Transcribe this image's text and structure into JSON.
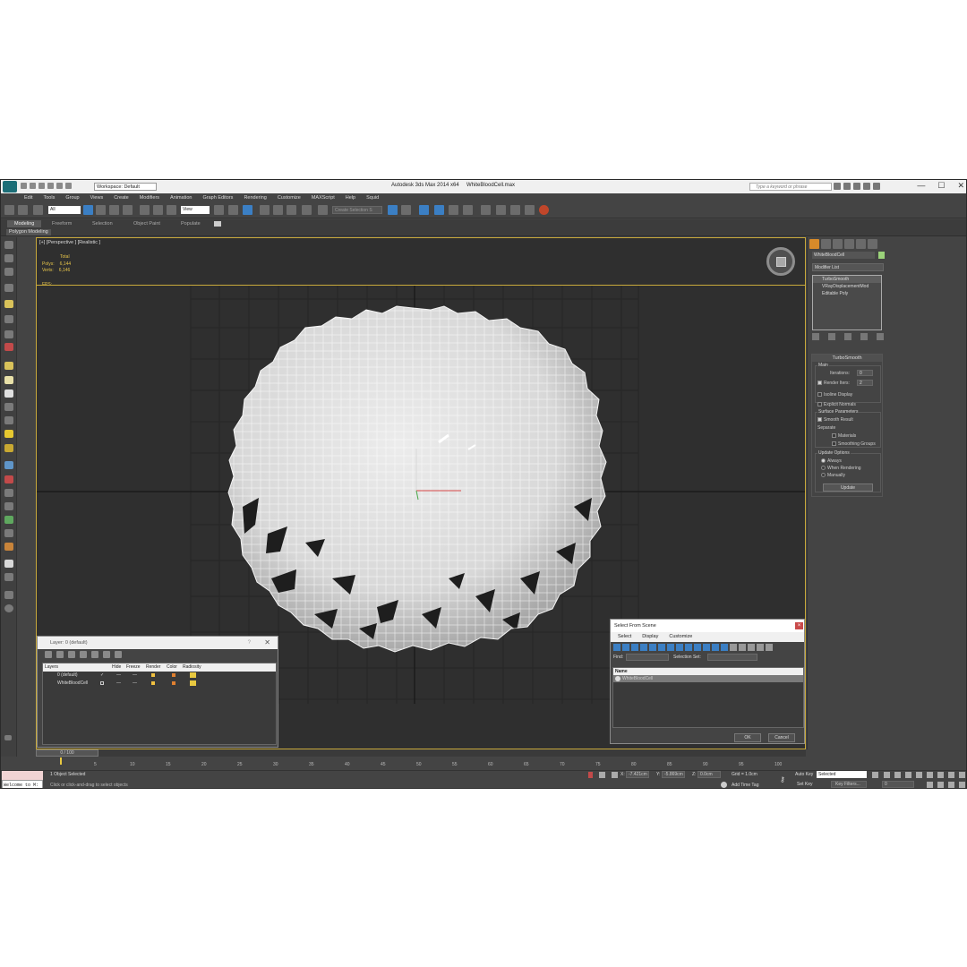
{
  "window": {
    "app_title": "Autodesk 3ds Max  2014 x64",
    "file_name": "WhiteBloodCell.max",
    "workspace": "Workspace: Default",
    "search_placeholder": "Type a keyword or phrase",
    "controls": [
      "—",
      "☐",
      "✕"
    ]
  },
  "menu": [
    "Edit",
    "Tools",
    "Group",
    "Views",
    "Create",
    "Modifiers",
    "Animation",
    "Graph Editors",
    "Rendering",
    "Customize",
    "MAXScript",
    "Help",
    "Squid"
  ],
  "toolbar": {
    "selection_filter": "All",
    "reference_coord": "View",
    "named_selection": "Create Selection S"
  },
  "ribbon": {
    "tabs": [
      "Modeling",
      "Freeform",
      "Selection",
      "Object Paint",
      "Populate"
    ],
    "active_tab": "Modeling",
    "panel": "Polygon Modeling"
  },
  "viewport": {
    "label": "[+] [Perspective ] [Realistic ]",
    "stats": {
      "total_label": "Total",
      "polys_label": "Polys:",
      "polys_value": "6,144",
      "verts_label": "Verts:",
      "verts_value": "6,146",
      "fps_label": "FPS:"
    }
  },
  "command_panel": {
    "object_name": "WhiteBloodCell",
    "object_color": "#9bd27a",
    "modifier_list": "Modifier List",
    "stack": [
      "TurboSmooth",
      "VRayDisplacementMod",
      "Editable Poly"
    ],
    "rollout_title": "TurboSmooth",
    "main_label": "Main",
    "iterations_label": "Iterations:",
    "iterations_value": "0",
    "render_iters_label": "Render Iters:",
    "render_iters_value": "2",
    "isoline_label": "Isoline Display",
    "explicit_normals_label": "Explicit Normals",
    "surface_params_label": "Surface Parameters",
    "smooth_result_label": "Smooth Result",
    "separate_label": "Separate",
    "materials_label": "Materials",
    "smoothing_groups_label": "Smoothing Groups",
    "update_options_label": "Update Options",
    "always_label": "Always",
    "when_rendering_label": "When Rendering",
    "manually_label": "Manually",
    "update_button": "Update"
  },
  "layer_dialog": {
    "title": "Layer: 0 (default)",
    "help": "?",
    "close": "✕",
    "columns": [
      "Layers",
      "Hide",
      "Freeze",
      "Render",
      "Color",
      "Radiosity"
    ],
    "rows": [
      {
        "name": "0 (default)",
        "hide": "✓",
        "freeze": "—",
        "render": "—"
      },
      {
        "name": "WhiteBloodCell",
        "hide": "—",
        "freeze": "—",
        "render": "—"
      }
    ]
  },
  "select_from_scene": {
    "title": "Select From Scene",
    "menu": [
      "Select",
      "Display",
      "Customize"
    ],
    "find_label": "Find:",
    "selection_set_label": "Selection Set:",
    "name_header": "Name",
    "items": [
      "WhiteBloodCell"
    ],
    "ok": "OK",
    "cancel": "Cancel"
  },
  "timeline": {
    "frame_display": "0 / 100",
    "ticks": [
      "5",
      "10",
      "15",
      "20",
      "25",
      "30",
      "35",
      "40",
      "45",
      "50",
      "55",
      "60",
      "65",
      "70",
      "75",
      "80",
      "85",
      "90",
      "95",
      "100"
    ]
  },
  "status": {
    "maxscript_text": "Welcome to M:",
    "selected": "1 Object Selected",
    "prompt": "Click or click-and-drag to select objects",
    "x_label": "X:",
    "x_value": "-7.421cm",
    "y_label": "Y:",
    "y_value": "-5.869cm",
    "z_label": "Z:",
    "z_value": "0.0cm",
    "grid": "Grid = 1.0cm",
    "add_time_tag": "Add Time Tag",
    "auto_key": "Auto Key",
    "set_key": "Set Key",
    "selected_dropdown": "Selected",
    "key_filters": "Key Filters...",
    "frame_value": "0"
  }
}
